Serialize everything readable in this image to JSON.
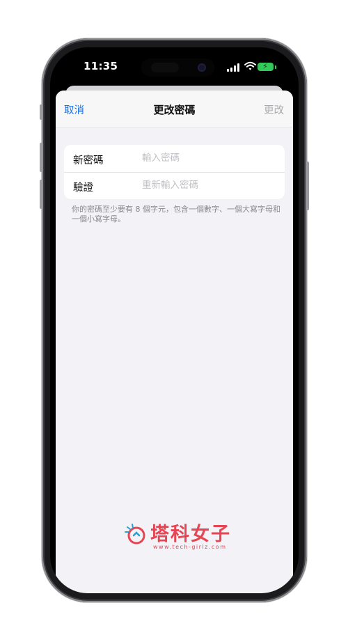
{
  "status_bar": {
    "time": "11:35"
  },
  "nav": {
    "cancel_label": "取消",
    "title": "更改密碼",
    "change_label": "更改"
  },
  "form": {
    "rows": [
      {
        "label": "新密碼",
        "placeholder": "輸入密碼"
      },
      {
        "label": "驗證",
        "placeholder": "重新輸入密碼"
      }
    ],
    "hint": "你的密碼至少要有 8 個字元，包含一個數字、一個大寫字母和一個小寫字母。"
  },
  "watermark": {
    "brand": "塔科女子",
    "url": "www.tech-girlz.com"
  },
  "colors": {
    "accent": "#1a73e8",
    "battery": "#34c759",
    "brand": "#e84553"
  }
}
